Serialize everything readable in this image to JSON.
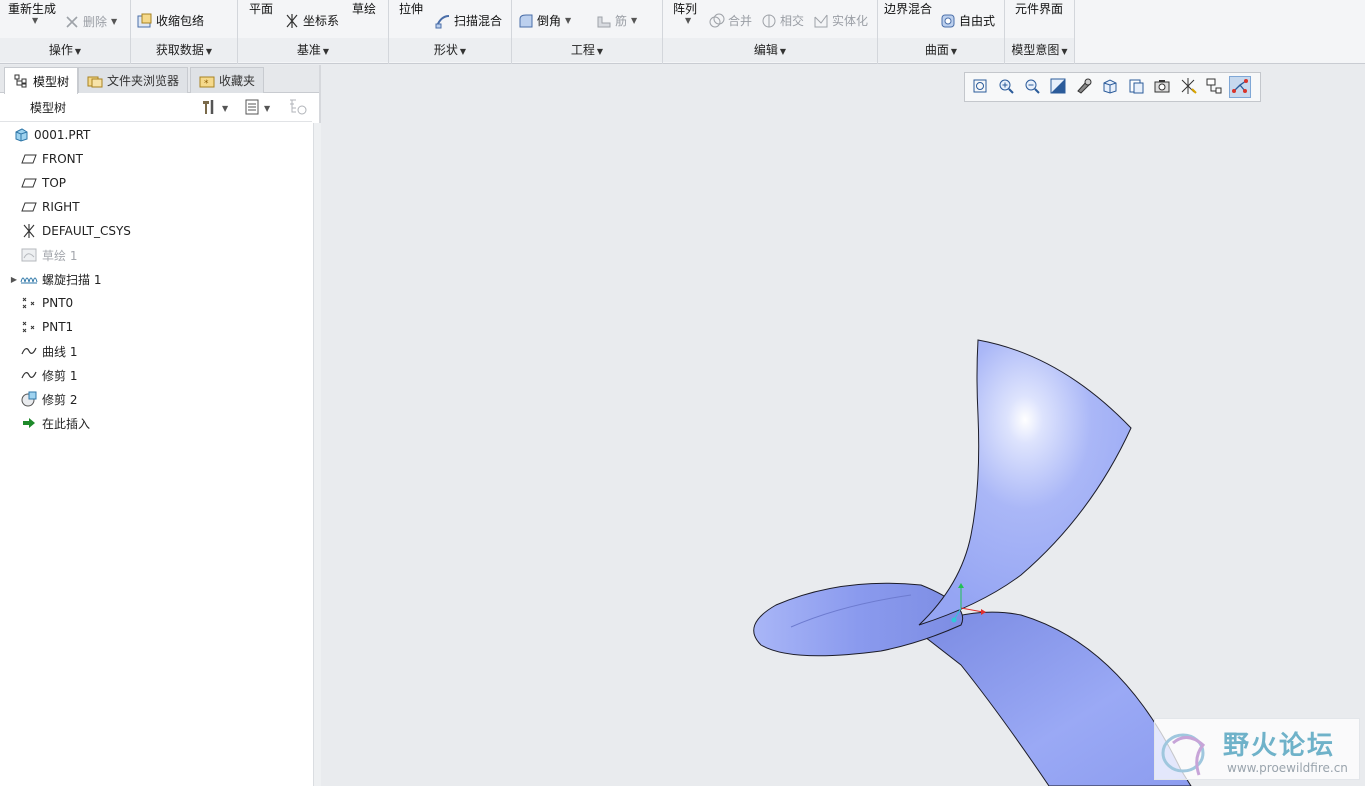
{
  "ribbon": {
    "groups": [
      {
        "label": "操作"
      },
      {
        "label": "获取数据"
      },
      {
        "label": "基准"
      },
      {
        "label": "形状"
      },
      {
        "label": "工程"
      },
      {
        "label": "编辑"
      },
      {
        "label": "曲面"
      },
      {
        "label": "模型意图"
      }
    ],
    "commands": {
      "regenerate": "重新生成",
      "delete": "删除",
      "shrinkwrap": "收缩包络",
      "plane": "平面",
      "sketch": "草绘",
      "csys": "坐标系",
      "extrude": "拉伸",
      "swept_blend": "扫描混合",
      "round": "倒角",
      "rib": "筋",
      "pattern": "阵列",
      "merge": "合并",
      "intersect": "相交",
      "solidify": "实体化",
      "boundary_blend": "边界混合",
      "freestyle": "自由式",
      "component_interface": "元件界面"
    }
  },
  "left_panel": {
    "tabs": [
      {
        "label": "模型树",
        "active": true
      },
      {
        "label": "文件夹浏览器",
        "active": false
      },
      {
        "label": "收藏夹",
        "active": false
      }
    ],
    "tree_title": "模型树",
    "nodes": [
      {
        "label": "0001.PRT",
        "icon": "part-icon"
      },
      {
        "label": "FRONT",
        "icon": "datum-plane-icon"
      },
      {
        "label": "TOP",
        "icon": "datum-plane-icon"
      },
      {
        "label": "RIGHT",
        "icon": "datum-plane-icon"
      },
      {
        "label": "DEFAULT_CSYS",
        "icon": "csys-icon"
      },
      {
        "label": "草绘 1",
        "icon": "sketch-icon",
        "suppressed": true
      },
      {
        "label": "螺旋扫描 1",
        "icon": "helical-sweep-icon",
        "expandable": true
      },
      {
        "label": "PNT0",
        "icon": "datum-point-icon"
      },
      {
        "label": "PNT1",
        "icon": "datum-point-icon"
      },
      {
        "label": "曲线 1",
        "icon": "curve-icon"
      },
      {
        "label": "修剪 1",
        "icon": "curve-icon"
      },
      {
        "label": "修剪 2",
        "icon": "trim-icon"
      },
      {
        "label": "在此插入",
        "icon": "insert-here-icon"
      }
    ]
  },
  "view_toolbar": {
    "buttons": [
      "refit-icon",
      "zoom-in-icon",
      "zoom-out-icon",
      "repaint-icon",
      "display-style-icon",
      "saved-orientations-icon",
      "view-manager-icon",
      "perspective-icon",
      "datum-display-icon",
      "annotation-display-icon",
      "spin-center-icon"
    ]
  },
  "watermark": {
    "title": "野火论坛",
    "url": "www.proewildfire.cn"
  },
  "colors": {
    "surface": "#a6b4f6",
    "surface_dark": "#7e8fe6",
    "background": "#e9ebee"
  }
}
